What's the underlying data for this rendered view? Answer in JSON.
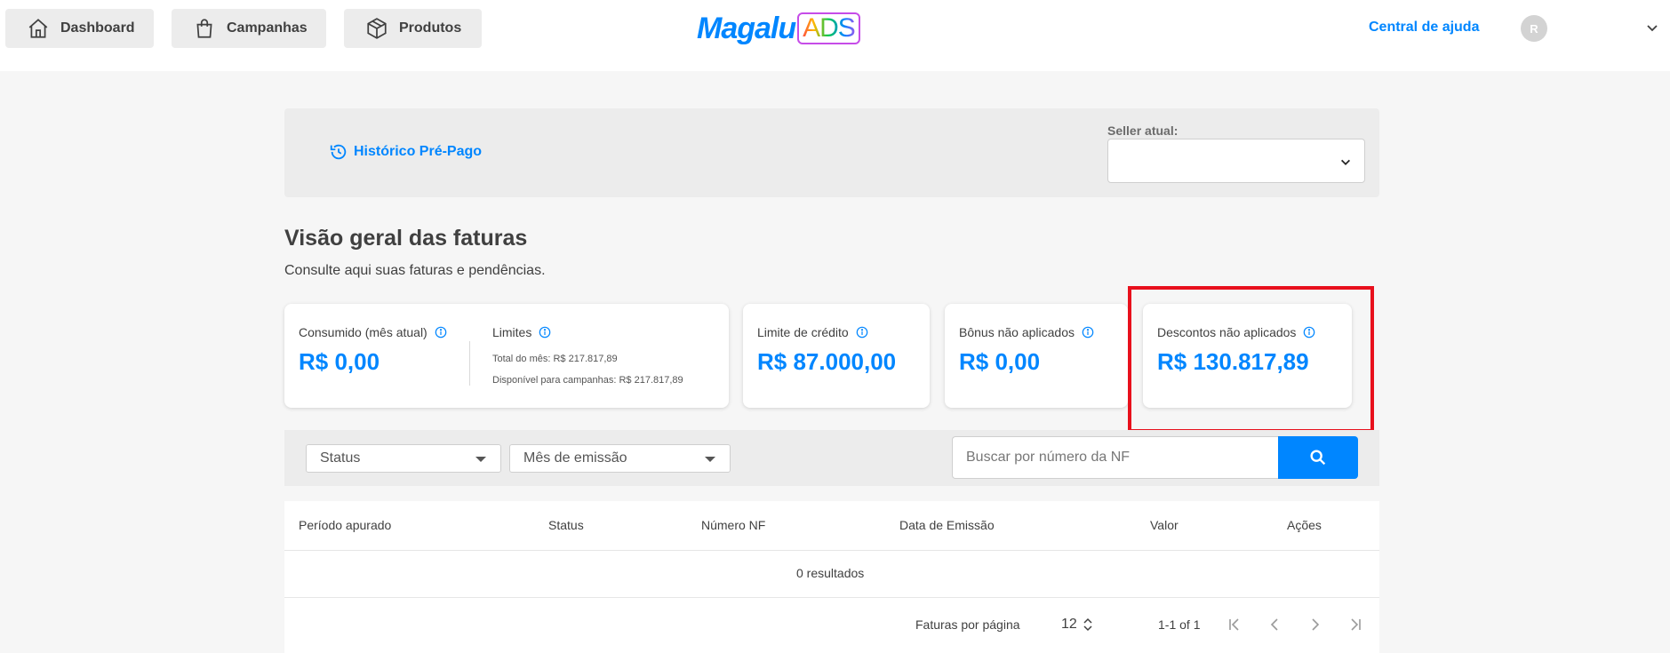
{
  "nav": {
    "dashboard": "Dashboard",
    "campaigns": "Campanhas",
    "products": "Produtos"
  },
  "logo": {
    "primary": "Magalu",
    "secondary": "ADS"
  },
  "header": {
    "help": "Central de ajuda",
    "avatar_initial": "R"
  },
  "toolbar": {
    "history_link": "Histórico Pré-Pago",
    "seller_label": "Seller atual:",
    "seller_value": ""
  },
  "page": {
    "title": "Visão geral das faturas",
    "subtitle": "Consulte aqui suas faturas e pendências."
  },
  "cards": {
    "consumed": {
      "label": "Consumido (mês atual)",
      "value": "R$ 0,00"
    },
    "limits": {
      "label": "Limites",
      "month_total": "Total do mês: R$ 217.817,89",
      "available": "Disponível para campanhas: R$ 217.817,89"
    },
    "credit_limit": {
      "label": "Limite de crédito",
      "value": "R$ 87.000,00"
    },
    "bonus": {
      "label": "Bônus não aplicados",
      "value": "R$ 0,00"
    },
    "discounts": {
      "label": "Descontos não aplicados",
      "value": "R$ 130.817,89"
    }
  },
  "filters": {
    "status": "Status",
    "emission_month": "Mês de emissão",
    "search_placeholder": "Buscar por número da NF"
  },
  "table": {
    "columns": [
      "Período apurado",
      "Status",
      "Número NF",
      "Data de Emissão",
      "Valor",
      "Ações"
    ],
    "empty": "0 resultados"
  },
  "pagination": {
    "per_page_label": "Faturas por página",
    "per_page_value": "12",
    "range": "1-1 of 1"
  },
  "colors": {
    "accent": "#0086ff",
    "highlight": "#e8101c"
  }
}
